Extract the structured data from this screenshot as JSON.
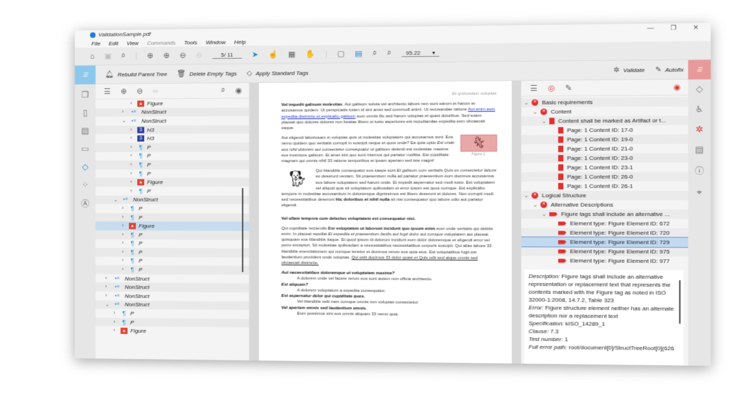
{
  "window": {
    "title": "ValidationSample.pdf",
    "controls": [
      "—",
      "❐",
      "✕"
    ]
  },
  "menu": [
    "File",
    "Edit",
    "View",
    "Commands",
    "Tools",
    "Window",
    "Help"
  ],
  "toolbar": {
    "page": "5/ 11",
    "zoom": "95.22"
  },
  "commands": {
    "rebuild": "Rebuild Parent Tree",
    "delete_empty": "Delete Empty Tags",
    "apply_standard": "Apply Standard Tags",
    "validate": "Validate",
    "autofix": "Autofix"
  },
  "tags_tree": [
    {
      "d": 3,
      "c": ">",
      "type": "Figure",
      "label": "Figure"
    },
    {
      "d": 2,
      "c": ">",
      "type": "NonStruct",
      "label": "NonStruct"
    },
    {
      "d": 2,
      "c": "v",
      "type": "NonStruct",
      "label": "NonStruct"
    },
    {
      "d": 3,
      "c": ">",
      "type": "H3",
      "label": "H3"
    },
    {
      "d": 3,
      "c": ">",
      "type": "H3",
      "label": "H3"
    },
    {
      "d": 3,
      "c": ">",
      "type": "P",
      "label": "P"
    },
    {
      "d": 3,
      "c": ">",
      "type": "P",
      "label": "P"
    },
    {
      "d": 3,
      "c": ">",
      "type": "P",
      "label": "P"
    },
    {
      "d": 3,
      "c": ">",
      "type": "P",
      "label": "P"
    },
    {
      "d": 3,
      "c": ">",
      "type": "Figure",
      "label": "Figure"
    },
    {
      "d": 3,
      "c": ">",
      "type": "P",
      "label": "P"
    },
    {
      "d": 1,
      "c": "v",
      "type": "NonStruct",
      "label": "NonStruct"
    },
    {
      "d": 2,
      "c": ">",
      "type": "P",
      "label": "P"
    },
    {
      "d": 2,
      "c": ">",
      "type": "P",
      "label": "P"
    },
    {
      "d": 2,
      "c": ">",
      "type": "Figure",
      "label": "Figure",
      "sel": true
    },
    {
      "d": 2,
      "c": ">",
      "type": "P",
      "label": "P"
    },
    {
      "d": 2,
      "c": ">",
      "type": "P",
      "label": "P"
    },
    {
      "d": 2,
      "c": ">",
      "type": "P",
      "label": "P"
    },
    {
      "d": 2,
      "c": ">",
      "type": "P",
      "label": "P"
    },
    {
      "d": 2,
      "c": ">",
      "type": "P",
      "label": "P"
    },
    {
      "d": 0,
      "c": ">",
      "type": "NonStruct",
      "label": "NonStruct"
    },
    {
      "d": 0,
      "c": ">",
      "type": "NonStruct",
      "label": "NonStruct"
    },
    {
      "d": 0,
      "c": ">",
      "type": "NonStruct",
      "label": "NonStruct"
    },
    {
      "d": 0,
      "c": "v",
      "type": "NonStruct",
      "label": "NonStruct"
    },
    {
      "d": 1,
      "c": ">",
      "type": "P",
      "label": "P"
    },
    {
      "d": 1,
      "c": ">",
      "type": "P",
      "label": "P"
    },
    {
      "d": 1,
      "c": ">",
      "type": "Figure",
      "label": "Figure"
    }
  ],
  "document": {
    "header": "Et quibusdam voluptas",
    "figure_caption": "Figure 2",
    "paragraphs": [
      [
        {
          "s": "b",
          "t": "Vel impedit galisum molestias"
        },
        {
          "t": ". Aut galisum soluta vel architecto labore rem sunt earum et harum et accusamus quidem. Ut perspiciatis totam id sint amet sed commodi animi. Ut recusandae ratione "
        },
        {
          "s": "a",
          "t": "Aut enim eum expedita distinctio et explicabo galisum"
        },
        {
          "t": " eum omnis illo sed harum voluptas et quasi doloribus. Sed totam placeat quo dolores dolores non beatae libero ut iusto asperiores est repudiandae expedita eum obcaecati eaque."
        }
      ],
      [
        {
          "t": "Aut eligendi laboriosam in voluptas quis ut molestias voluptatem qui accusamus sunt. Eos nemo quidem quo veritatis corrupti in suscipit neque et quos unde? Ea quia optio "
        },
        {
          "s": "i",
          "t": "Est unde eos nihil dolorem aut consectetur consequatur"
        },
        {
          "t": " ut galisum deleniti est molestiae maxime eos inventore galisum. Et amet sint quo sunt internos qui pariatur mollitia. Est cupiditate magnam qui omnis nihil 33 ratione temporibus et ipsam aperiam sed iste magni!"
        }
      ],
      [
        {
          "t": "Qui blanditiis consequatur eos saepe sunt "
        },
        {
          "s": "i",
          "t": "Et galisum cum veritatis Quis ex consectetur labore eo deserunt veniam"
        },
        {
          "t": ". Sit praesentium nulla ad pariatur praesentium eum ducimus accusamus eos labore voluptatem sed harum unde. Et impedit aspernatur sed modi iusto. Est voluptatem vel aliquid quis sit voluptatum quibusdam et error ipsum est quos cumque. Est explicabo tempore in molestiae accusantium in doloremque dignissimos est libero deserunt et dolores. Non corrupti modi sed necessitatibus deserunt "
        },
        {
          "s": "b",
          "t": "Hic doloribus et nihil nulla"
        },
        {
          "t": " sit nisi consequatur quo labore odio aut pariatur eligendi."
        }
      ],
      [
        {
          "s": "b",
          "t": "Vel ullam tempora cum delectus voluptatem est consequatur nisi."
        }
      ],
      [
        {
          "t": "Qui cupiditate reiciendis "
        },
        {
          "s": "b",
          "t": "Est voluptatem ut laborum incidunt quo ipsum enim"
        },
        {
          "t": " eum unde veritatis qui debitis enim. In placeat repellat "
        },
        {
          "s": "i",
          "t": "Et expedita et praesentium facilis aut fugit dolor aut cumque voluptatem"
        },
        {
          "t": " aut placeat quisquam eos blanditiis itaque. Et quod ipsum id dolorum incidunt eum dolor doloremque et eligendi error vel porro excepturi. Sit molestiae quibusdam a necessitatibus necessitatibus corporis suscipit. Qui alias labore 33 blanditiis exercitationem qui cumque tenetur et ducimus rerum eos quia eius. Est voluptatibus fugit est laudantium provident unde voluptas. "
        },
        {
          "s": "u",
          "t": "Qui velit ducimus 33 dolor quasi et Quis odit sed atque omnis sed obcaecati distinctio."
        }
      ]
    ],
    "qa": [
      {
        "q": "Aut necessitatibus doloremque ut voluptatem maxime?",
        "a": "A dolorem unde vel facere rerum eos sunt autem non officia architecto."
      },
      {
        "q": "Est aliquam?",
        "a": "A dolorem voluptatum a expedita consequatur."
      },
      {
        "q": "Est aspernatur dolor qui cupiditate quos.",
        "a": "Vel blanditiis velit nam cumque omnis non voluptas consectetur."
      },
      {
        "q": "Vel aperiam omnis sed laudantium omnis.",
        "a": "Eum possimus sint eos omnis aliquam 33 nemo quia."
      }
    ]
  },
  "results": [
    {
      "d": 0,
      "c": "v",
      "icon": "x",
      "label": "Basic requirements"
    },
    {
      "d": 1,
      "c": "v",
      "icon": "x",
      "label": "Content"
    },
    {
      "d": 2,
      "c": "v",
      "icon": "p",
      "label": "Content shall be marked as Artifact or t..."
    },
    {
      "d": 3,
      "icon": "p",
      "label": "Page: 1 Content ID: 17-0"
    },
    {
      "d": 3,
      "icon": "p",
      "label": "Page: 1 Content ID: 19-0"
    },
    {
      "d": 3,
      "icon": "p",
      "label": "Page: 1 Content ID: 21-0"
    },
    {
      "d": 3,
      "icon": "p",
      "label": "Page: 1 Content ID: 23-0"
    },
    {
      "d": 3,
      "icon": "p",
      "label": "Page: 1 Content ID: 23-1"
    },
    {
      "d": 3,
      "icon": "p",
      "label": "Page: 1 Content ID: 26-0"
    },
    {
      "d": 3,
      "icon": "p",
      "label": "Page: 1 Content ID: 26-1"
    },
    {
      "d": 0,
      "c": "v",
      "icon": "x",
      "label": "Logical Structure"
    },
    {
      "d": 1,
      "c": "v",
      "icon": "x",
      "label": "Alternative Descriptions"
    },
    {
      "d": 2,
      "c": "v",
      "icon": "t",
      "label": "Figure tags shall include an alternative ..."
    },
    {
      "d": 3,
      "icon": "t",
      "label": "Element type: Figure Element ID:  672"
    },
    {
      "d": 3,
      "icon": "t",
      "label": "Element type: Figure Element ID:  720"
    },
    {
      "d": 3,
      "icon": "t",
      "label": "Element type: Figure Element ID:  729",
      "sel": true
    },
    {
      "d": 3,
      "icon": "t",
      "label": "Element type: Figure Element ID:  975"
    },
    {
      "d": 3,
      "icon": "t",
      "label": "Element type: Figure Element ID:  977"
    }
  ],
  "details": {
    "description_label": "Description:",
    "description": " Figure tags shall include an alternative representation or replacement text that represents the contents marked with the Figure tag as noted in ISO 32000-1:2008, 14.7.2, Table 323",
    "error_label": "Error:",
    "error": " Figure structure element neither has an alternate description nor a replacement text",
    "spec_label": "Specification:",
    "spec": " kISO_14289_1",
    "clause_label": "Clause:",
    "clause": " 7.3",
    "test_label": "Test number:",
    "test": " 1",
    "path_label": "Full error path:",
    "path": " root/document[0]/StructTreeRoot[0](626"
  },
  "colors": {
    "accent": "#1a8ad8",
    "error": "#e03030",
    "selection": "#c2d9f0"
  }
}
